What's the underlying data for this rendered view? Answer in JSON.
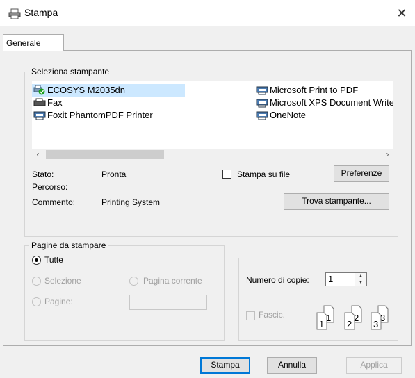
{
  "window": {
    "title": "Stampa",
    "close_glyph": "✕"
  },
  "tabs": [
    {
      "label": "Generale"
    }
  ],
  "select_printer": {
    "legend": "Seleziona stampante",
    "printers": [
      {
        "name": "ECOSYS M2035dn",
        "icon": "default-printer-icon"
      },
      {
        "name": "Fax",
        "icon": "fax-icon"
      },
      {
        "name": "Foxit PhantomPDF Printer",
        "icon": "printer-icon"
      },
      {
        "name": "Microsoft Print to PDF",
        "icon": "printer-icon"
      },
      {
        "name": "Microsoft XPS Document Writer",
        "icon": "printer-icon"
      },
      {
        "name": "OneNote",
        "icon": "printer-icon"
      }
    ],
    "selected": "ECOSYS M2035dn",
    "status_label": "Stato:",
    "status_value": "Pronta",
    "path_label": "Percorso:",
    "path_value": "",
    "comment_label": "Commento:",
    "comment_value": "Printing System",
    "print_to_file_label": "Stampa su file",
    "preferences_label": "Preferenze",
    "find_printer_label": "Trova stampante..."
  },
  "page_range": {
    "legend": "Pagine da stampare",
    "all_label": "Tutte",
    "selection_label": "Selezione",
    "current_page_label": "Pagina corrente",
    "pages_label": "Pagine:",
    "pages_value": ""
  },
  "copies": {
    "label": "Numero di copie:",
    "value": "1",
    "collate_label": "Fascic.",
    "collate_numbers": [
      "1",
      "1",
      "2",
      "2",
      "3",
      "3"
    ]
  },
  "footer": {
    "print_label": "Stampa",
    "cancel_label": "Annulla",
    "apply_label": "Applica"
  }
}
